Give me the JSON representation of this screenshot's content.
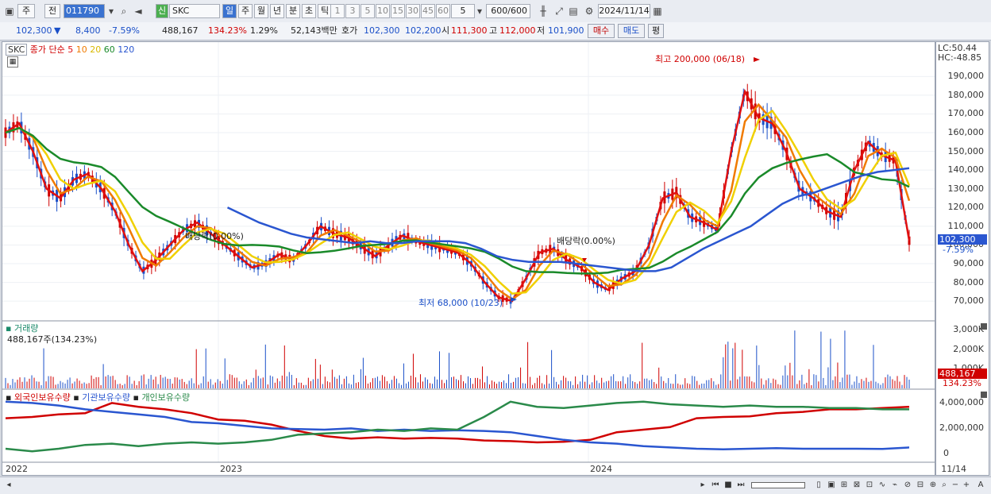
{
  "toolbar": {
    "period_mode": "주",
    "prev_label": "전",
    "stock_code": "011790",
    "new_label": "신",
    "stock_name": "SKC",
    "periods": [
      "일",
      "주",
      "월",
      "년",
      "분",
      "초",
      "틱"
    ],
    "minutes": [
      "1",
      "3",
      "5",
      "10",
      "15",
      "30",
      "45",
      "60"
    ],
    "interval": "5",
    "count": "600/600",
    "date": "2024/11/14"
  },
  "quote": {
    "price": "102,300",
    "arrow": "▼",
    "change": "8,400",
    "change_pct": "-7.59%",
    "volume": "488,167",
    "volume_ratio": "134.23%",
    "turnover": "1.29%",
    "amount": "52,143백만",
    "bid_label": "호가",
    "bid1": "102,300",
    "bid2": "102,200",
    "open_label": "시",
    "open": "111,300",
    "high_label": "고",
    "high": "112,000",
    "low_label": "저",
    "low": "101,900",
    "buy_label": "매수",
    "sell_label": "매도",
    "avg_label": "평"
  },
  "price_panel": {
    "symbol": "SKC",
    "ma_title": "종가 단순",
    "ma_periods": [
      "5",
      "10",
      "20",
      "60",
      "120"
    ],
    "ma_colors": [
      "#e01010",
      "#f07a00",
      "#f0d000",
      "#1a8a2a",
      "#2a56d0"
    ],
    "lc": "LC:50.44",
    "hc": "HC:-48.85",
    "high_note": "최고 200,000 (06/18)",
    "low_note": "최저 68,000 (10/23)",
    "dividend_1": "배당락(0.00%)",
    "dividend_2": "배당락(0.00%)",
    "current_price": "102,300",
    "current_pct": "-7.59%",
    "y_ticks": [
      "190,000",
      "180,000",
      "170,000",
      "160,000",
      "150,000",
      "140,000",
      "130,000",
      "120,000",
      "110,000",
      "100,000",
      "90,000",
      "80,000",
      "70,000"
    ]
  },
  "volume_panel": {
    "title": "거래량",
    "value": "488,167주(134.23%)",
    "y_ticks": [
      "3,000K",
      "2,000K",
      "1,000K"
    ],
    "current": "488,167",
    "current_pct": "134.23%"
  },
  "holding_panel": {
    "series": [
      "외국인보유수량",
      "기관보유수량",
      "개인보유수량"
    ],
    "colors": [
      "#d00000",
      "#2a56d0",
      "#2a8a4a"
    ],
    "y_ticks": [
      "4,000,000",
      "2,000,000",
      "0"
    ]
  },
  "x_labels": [
    "2022",
    "2023",
    "2024"
  ],
  "last_date": "11/14",
  "chart_data": {
    "type": "line",
    "title": "SKC",
    "ylim": [
      62000,
      205000
    ],
    "series": [
      {
        "name": "5",
        "values": [
          160000,
          165000,
          150000,
          130000,
          125000,
          135000,
          138000,
          130000,
          118000,
          100000,
          86000,
          92000,
          100000,
          108000,
          112000,
          106000,
          100000,
          94000,
          88000,
          90000,
          95000,
          92000,
          100000,
          110000,
          106000,
          104000,
          99000,
          94000,
          100000,
          105000,
          102000,
          100000,
          98000,
          96000,
          90000,
          80000,
          72000,
          70000,
          82000,
          96000,
          98000,
          92000,
          88000,
          80000,
          76000,
          82000,
          86000,
          100000,
          125000,
          128000,
          115000,
          112000,
          108000,
          150000,
          182000,
          168000,
          165000,
          150000,
          130000,
          125000,
          118000,
          115000,
          140000,
          155000,
          148000,
          145000,
          102300
        ]
      },
      {
        "name": "120",
        "values": [
          null,
          null,
          null,
          null,
          null,
          null,
          null,
          null,
          null,
          null,
          null,
          null,
          null,
          null,
          120000,
          116000,
          112000,
          109000,
          106000,
          104000,
          103000,
          102000,
          101000,
          102000,
          101000,
          101000,
          102000,
          102000,
          102000,
          101000,
          98000,
          94000,
          92000,
          91000,
          91000,
          91000,
          90000,
          89000,
          88000,
          87000,
          86000,
          86000,
          88000,
          93000,
          98000,
          102000,
          106000,
          110000,
          116000,
          122000,
          126000,
          128000,
          131000,
          134000,
          137000,
          139000,
          140000,
          141000
        ]
      }
    ]
  }
}
